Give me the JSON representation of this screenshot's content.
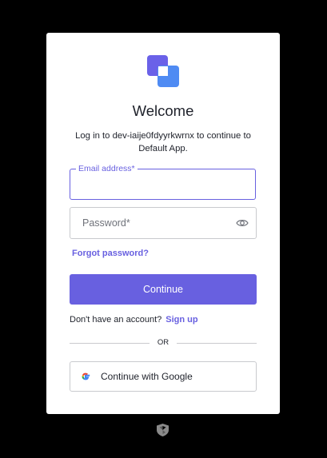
{
  "page": {
    "title": "Welcome",
    "subtitle": "Log in to dev-iaije0fdyyrkwrnx to continue to Default App."
  },
  "form": {
    "email_label": "Email address*",
    "email_value": "",
    "password_placeholder": "Password*",
    "password_value": "",
    "forgot_password": "Forgot password?",
    "continue_label": "Continue"
  },
  "signup": {
    "prompt": "Don't have an account?",
    "link": "Sign up"
  },
  "divider": {
    "text": "OR"
  },
  "social": {
    "google_label": "Continue with Google"
  },
  "icons": {
    "logo": "app-logo-icon",
    "password_toggle": "eye-icon",
    "google": "google-icon",
    "footer": "shield-icon"
  },
  "colors": {
    "accent": "#6860e0",
    "logo_primary": "#6a61e8",
    "logo_secondary": "#4f8bf3",
    "background": "#000000",
    "card": "#ffffff"
  }
}
